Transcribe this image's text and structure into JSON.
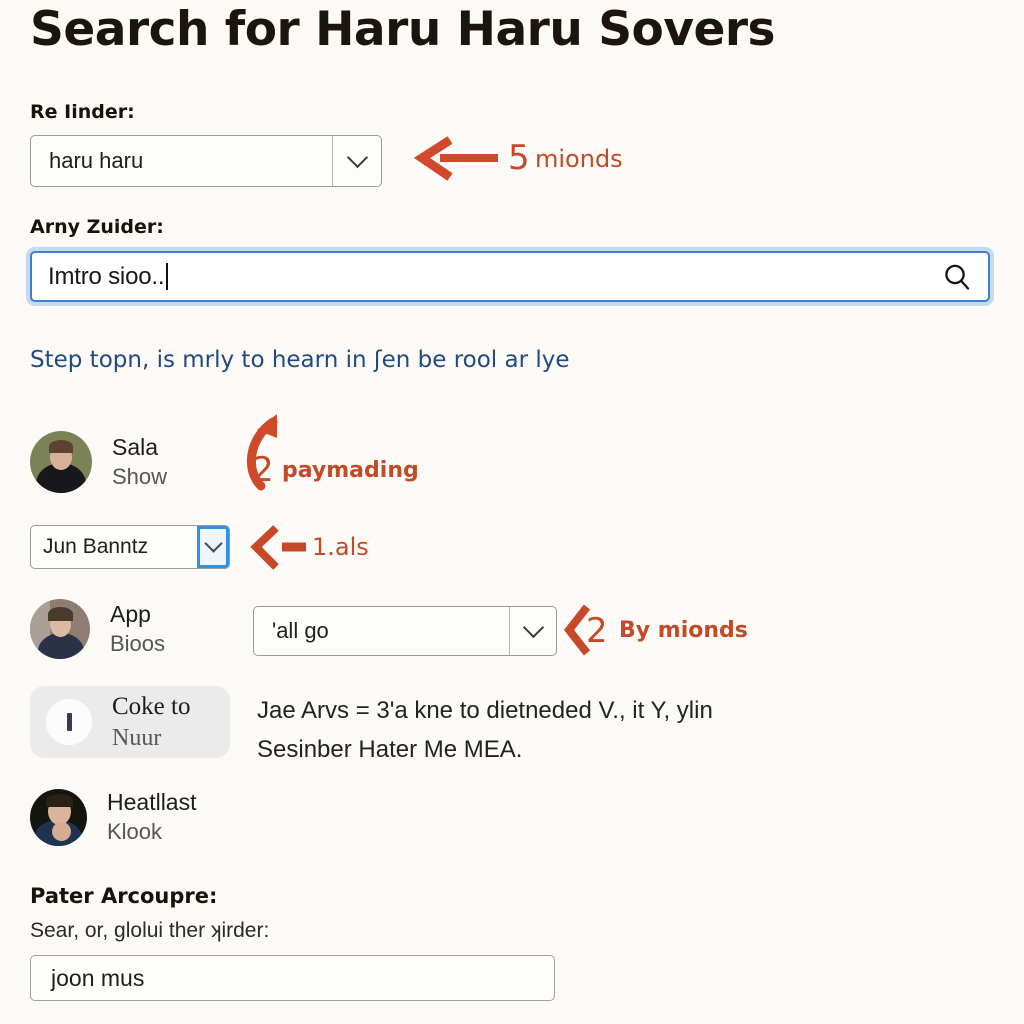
{
  "page": {
    "title": "Search for Haru Haru Sovers",
    "background_color": "#fbfaf7",
    "accent_annotation_color": "#c8492a",
    "focus_color": "#3d7fd0",
    "hint_color": "#23497f"
  },
  "finder_field": {
    "label": "Re Iinder:",
    "value": "haru haru",
    "chevron_icon": "chevron-down-icon"
  },
  "search_field": {
    "label": "Arny Zuider:",
    "value": "Imtro sioo..",
    "icon": "search-icon",
    "focused": true
  },
  "hint": {
    "text": "Step topn, is mrly to hearn in ʃen be rool ar lye"
  },
  "results": [
    {
      "name": "Sala",
      "sub": "Show",
      "avatar_icon": "user-avatar-photo",
      "highlighted": false
    },
    {
      "name": "App",
      "sub": "Bioos",
      "avatar_icon": "user-avatar-photo",
      "highlighted": false
    },
    {
      "name": "Coke to",
      "sub": "Nuur",
      "avatar_icon": "user-avatar-placeholder",
      "highlighted": true
    },
    {
      "name": "Heatllast",
      "sub": "Klook",
      "avatar_icon": "user-avatar-photo",
      "highlighted": false
    }
  ],
  "sorter_select": {
    "value": "Jun Banntz",
    "chevron_icon": "chevron-down-icon",
    "focused": true
  },
  "scope_select": {
    "value": "'all go",
    "chevron_icon": "chevron-down-icon"
  },
  "body_paragraph": {
    "text": "Jae Arvs = 3'a kne to dietneded V., it Y, ylin\nSesinber Hater Me MEA."
  },
  "footer": {
    "label": "Pater Arcoupre:",
    "sub_label": "Sear, or, glolui ther ʞirder:",
    "input_value": "joon mus"
  },
  "annotations": [
    {
      "id": "a1",
      "number": "5",
      "text": "mionds",
      "arrow_icon": "arrow-left-icon"
    },
    {
      "id": "a2",
      "number": "2",
      "text": "paymading",
      "arrow_icon": "arrow-curve-up-icon"
    },
    {
      "id": "a3",
      "number": "",
      "text": "1.als",
      "arrow_icon": "arrow-left-chevron-icon"
    },
    {
      "id": "a4",
      "number": "2",
      "text": "By mionds",
      "arrow_icon": "chevron-left-icon"
    }
  ]
}
